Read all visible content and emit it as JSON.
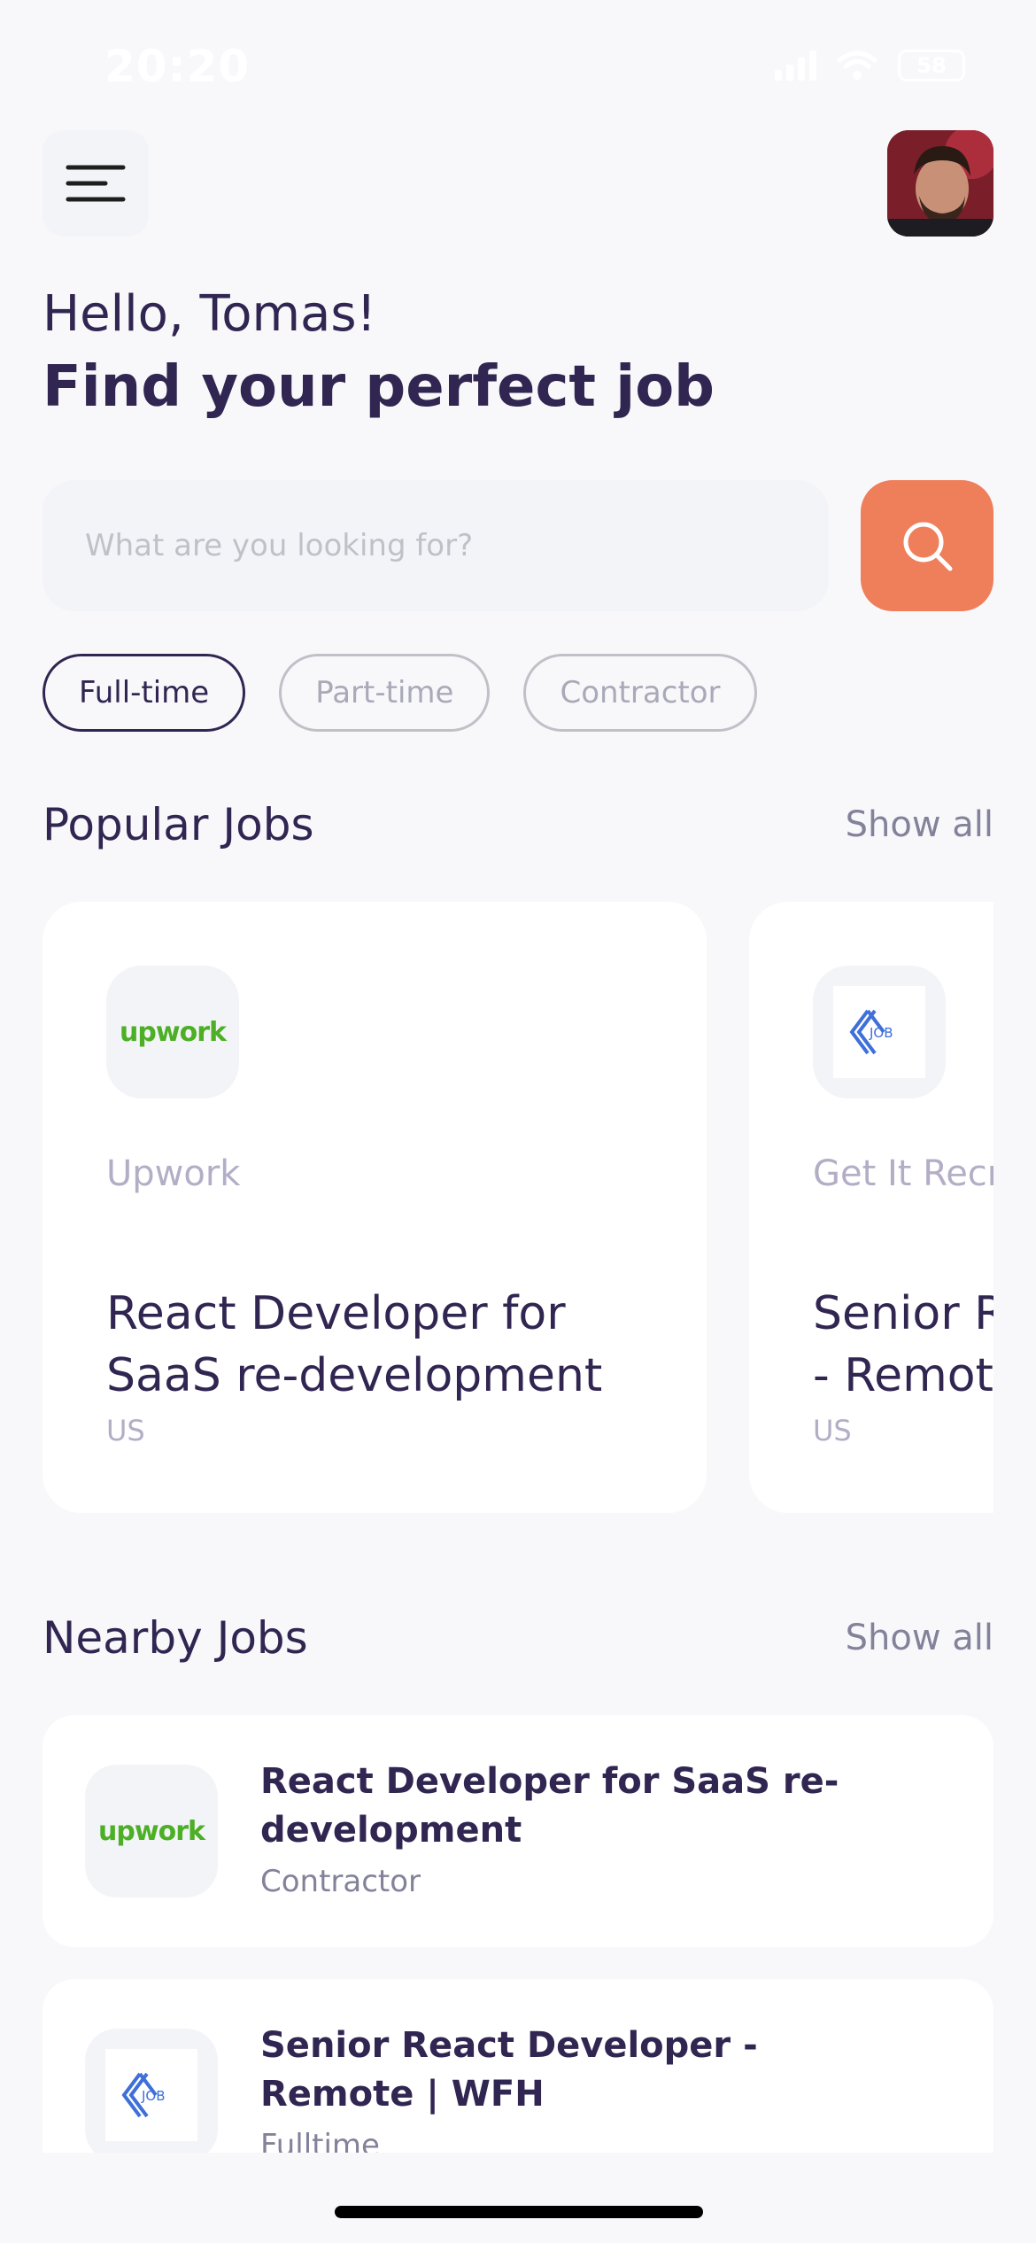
{
  "status_bar": {
    "time": "20:20",
    "battery": "58"
  },
  "header": {
    "greeting": "Hello, Tomas!",
    "headline": "Find your perfect job"
  },
  "search": {
    "placeholder": "What are you looking for?"
  },
  "job_types": [
    "Full-time",
    "Part-time",
    "Contractor"
  ],
  "active_job_type": "Full-time",
  "popular": {
    "title": "Popular Jobs",
    "show_all": "Show all",
    "cards": [
      {
        "company": "Upwork",
        "logo_text": "upwork",
        "title_line1": "React Developer for",
        "title_line2": "SaaS re-development",
        "location": "US"
      },
      {
        "company": "Get It Recruit",
        "logo_text": "JOB",
        "title_line1": "Senior React Developer",
        "title_line2": "- Remote | WFH",
        "location": "US"
      }
    ]
  },
  "nearby": {
    "title": "Nearby Jobs",
    "show_all": "Show all",
    "items": [
      {
        "logo_text": "upwork",
        "title": "React Developer for SaaS re-development",
        "type": "Contractor"
      },
      {
        "logo_text": "JOB",
        "title": "Senior React Developer - Remote | WFH",
        "type": "Fulltime"
      }
    ]
  },
  "colors": {
    "primary": "#312651",
    "accent": "#EF7E5A",
    "background": "#F8F8FB",
    "upwork_green": "#4CAF25",
    "job_logo_blue": "#3F6FD9"
  },
  "icons": {
    "menu": "hamburger-menu-icon",
    "search": "search-icon",
    "upwork": "upwork-logo",
    "job": "job-logo"
  }
}
